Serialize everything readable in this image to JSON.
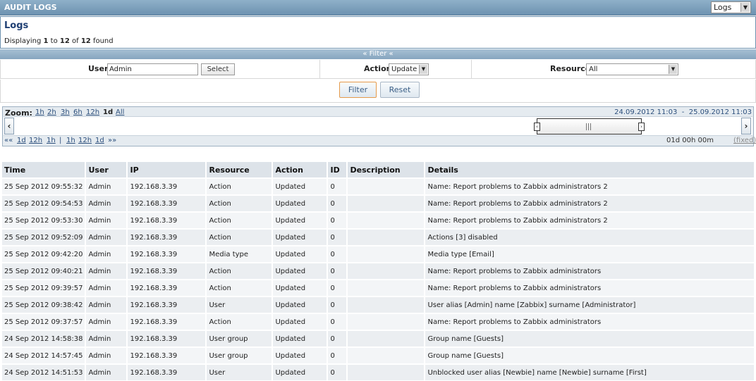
{
  "header": {
    "title": "AUDIT LOGS",
    "view_select": "Logs"
  },
  "info": {
    "title": "Logs",
    "displaying_prefix": "Displaying",
    "from": "1",
    "to_word": "to",
    "to": "12",
    "of_word": "of",
    "total": "12",
    "found_word": "found"
  },
  "filter_toggle": "« Filter «",
  "filter": {
    "user_label": "User",
    "user_value": "Admin",
    "select_button": "Select",
    "action_label": "Action",
    "action_value": "Update",
    "resource_label": "Resource",
    "resource_value": "All",
    "filter_button": "Filter",
    "reset_button": "Reset"
  },
  "timeline": {
    "zoom_label": "Zoom:",
    "zoom_options": [
      "1h",
      "2h",
      "3h",
      "6h",
      "12h",
      "1d",
      "All"
    ],
    "zoom_selected": "1d",
    "date_from": "24.09.2012 11:03",
    "date_sep": "-",
    "date_to": "25.09.2012 11:03",
    "nav_back_all": "««",
    "nav_back": [
      "1d",
      "12h",
      "1h"
    ],
    "nav_sep": "|",
    "nav_forward": [
      "1h",
      "12h",
      "1d"
    ],
    "nav_forward_all": "»»",
    "period": "01d 00h 00m",
    "fixed_label": "(fixed)"
  },
  "table": {
    "columns": [
      "Time",
      "User",
      "IP",
      "Resource",
      "Action",
      "ID",
      "Description",
      "Details"
    ],
    "rows": [
      [
        "25 Sep 2012 09:55:32",
        "Admin",
        "192.168.3.39",
        "Action",
        "Updated",
        "0",
        "",
        "Name: Report problems to Zabbix administrators 2"
      ],
      [
        "25 Sep 2012 09:54:53",
        "Admin",
        "192.168.3.39",
        "Action",
        "Updated",
        "0",
        "",
        "Name: Report problems to Zabbix administrators 2"
      ],
      [
        "25 Sep 2012 09:53:30",
        "Admin",
        "192.168.3.39",
        "Action",
        "Updated",
        "0",
        "",
        "Name: Report problems to Zabbix administrators 2"
      ],
      [
        "25 Sep 2012 09:52:09",
        "Admin",
        "192.168.3.39",
        "Action",
        "Updated",
        "0",
        "",
        "Actions [3] disabled"
      ],
      [
        "25 Sep 2012 09:42:20",
        "Admin",
        "192.168.3.39",
        "Media type",
        "Updated",
        "0",
        "",
        "Media type [Email]"
      ],
      [
        "25 Sep 2012 09:40:21",
        "Admin",
        "192.168.3.39",
        "Action",
        "Updated",
        "0",
        "",
        "Name: Report problems to Zabbix administrators"
      ],
      [
        "25 Sep 2012 09:39:57",
        "Admin",
        "192.168.3.39",
        "Action",
        "Updated",
        "0",
        "",
        "Name: Report problems to Zabbix administrators"
      ],
      [
        "25 Sep 2012 09:38:42",
        "Admin",
        "192.168.3.39",
        "User",
        "Updated",
        "0",
        "",
        "User alias [Admin] name [Zabbix] surname [Administrator]"
      ],
      [
        "25 Sep 2012 09:37:57",
        "Admin",
        "192.168.3.39",
        "Action",
        "Updated",
        "0",
        "",
        "Name: Report problems to Zabbix administrators"
      ],
      [
        "24 Sep 2012 14:58:38",
        "Admin",
        "192.168.3.39",
        "User group",
        "Updated",
        "0",
        "",
        "Group name [Guests]"
      ],
      [
        "24 Sep 2012 14:57:45",
        "Admin",
        "192.168.3.39",
        "User group",
        "Updated",
        "0",
        "",
        "Group name [Guests]"
      ],
      [
        "24 Sep 2012 14:51:53",
        "Admin",
        "192.168.3.39",
        "User",
        "Updated",
        "0",
        "",
        "Unblocked user alias [Newbie] name [Newbie] surname [First]"
      ]
    ]
  }
}
